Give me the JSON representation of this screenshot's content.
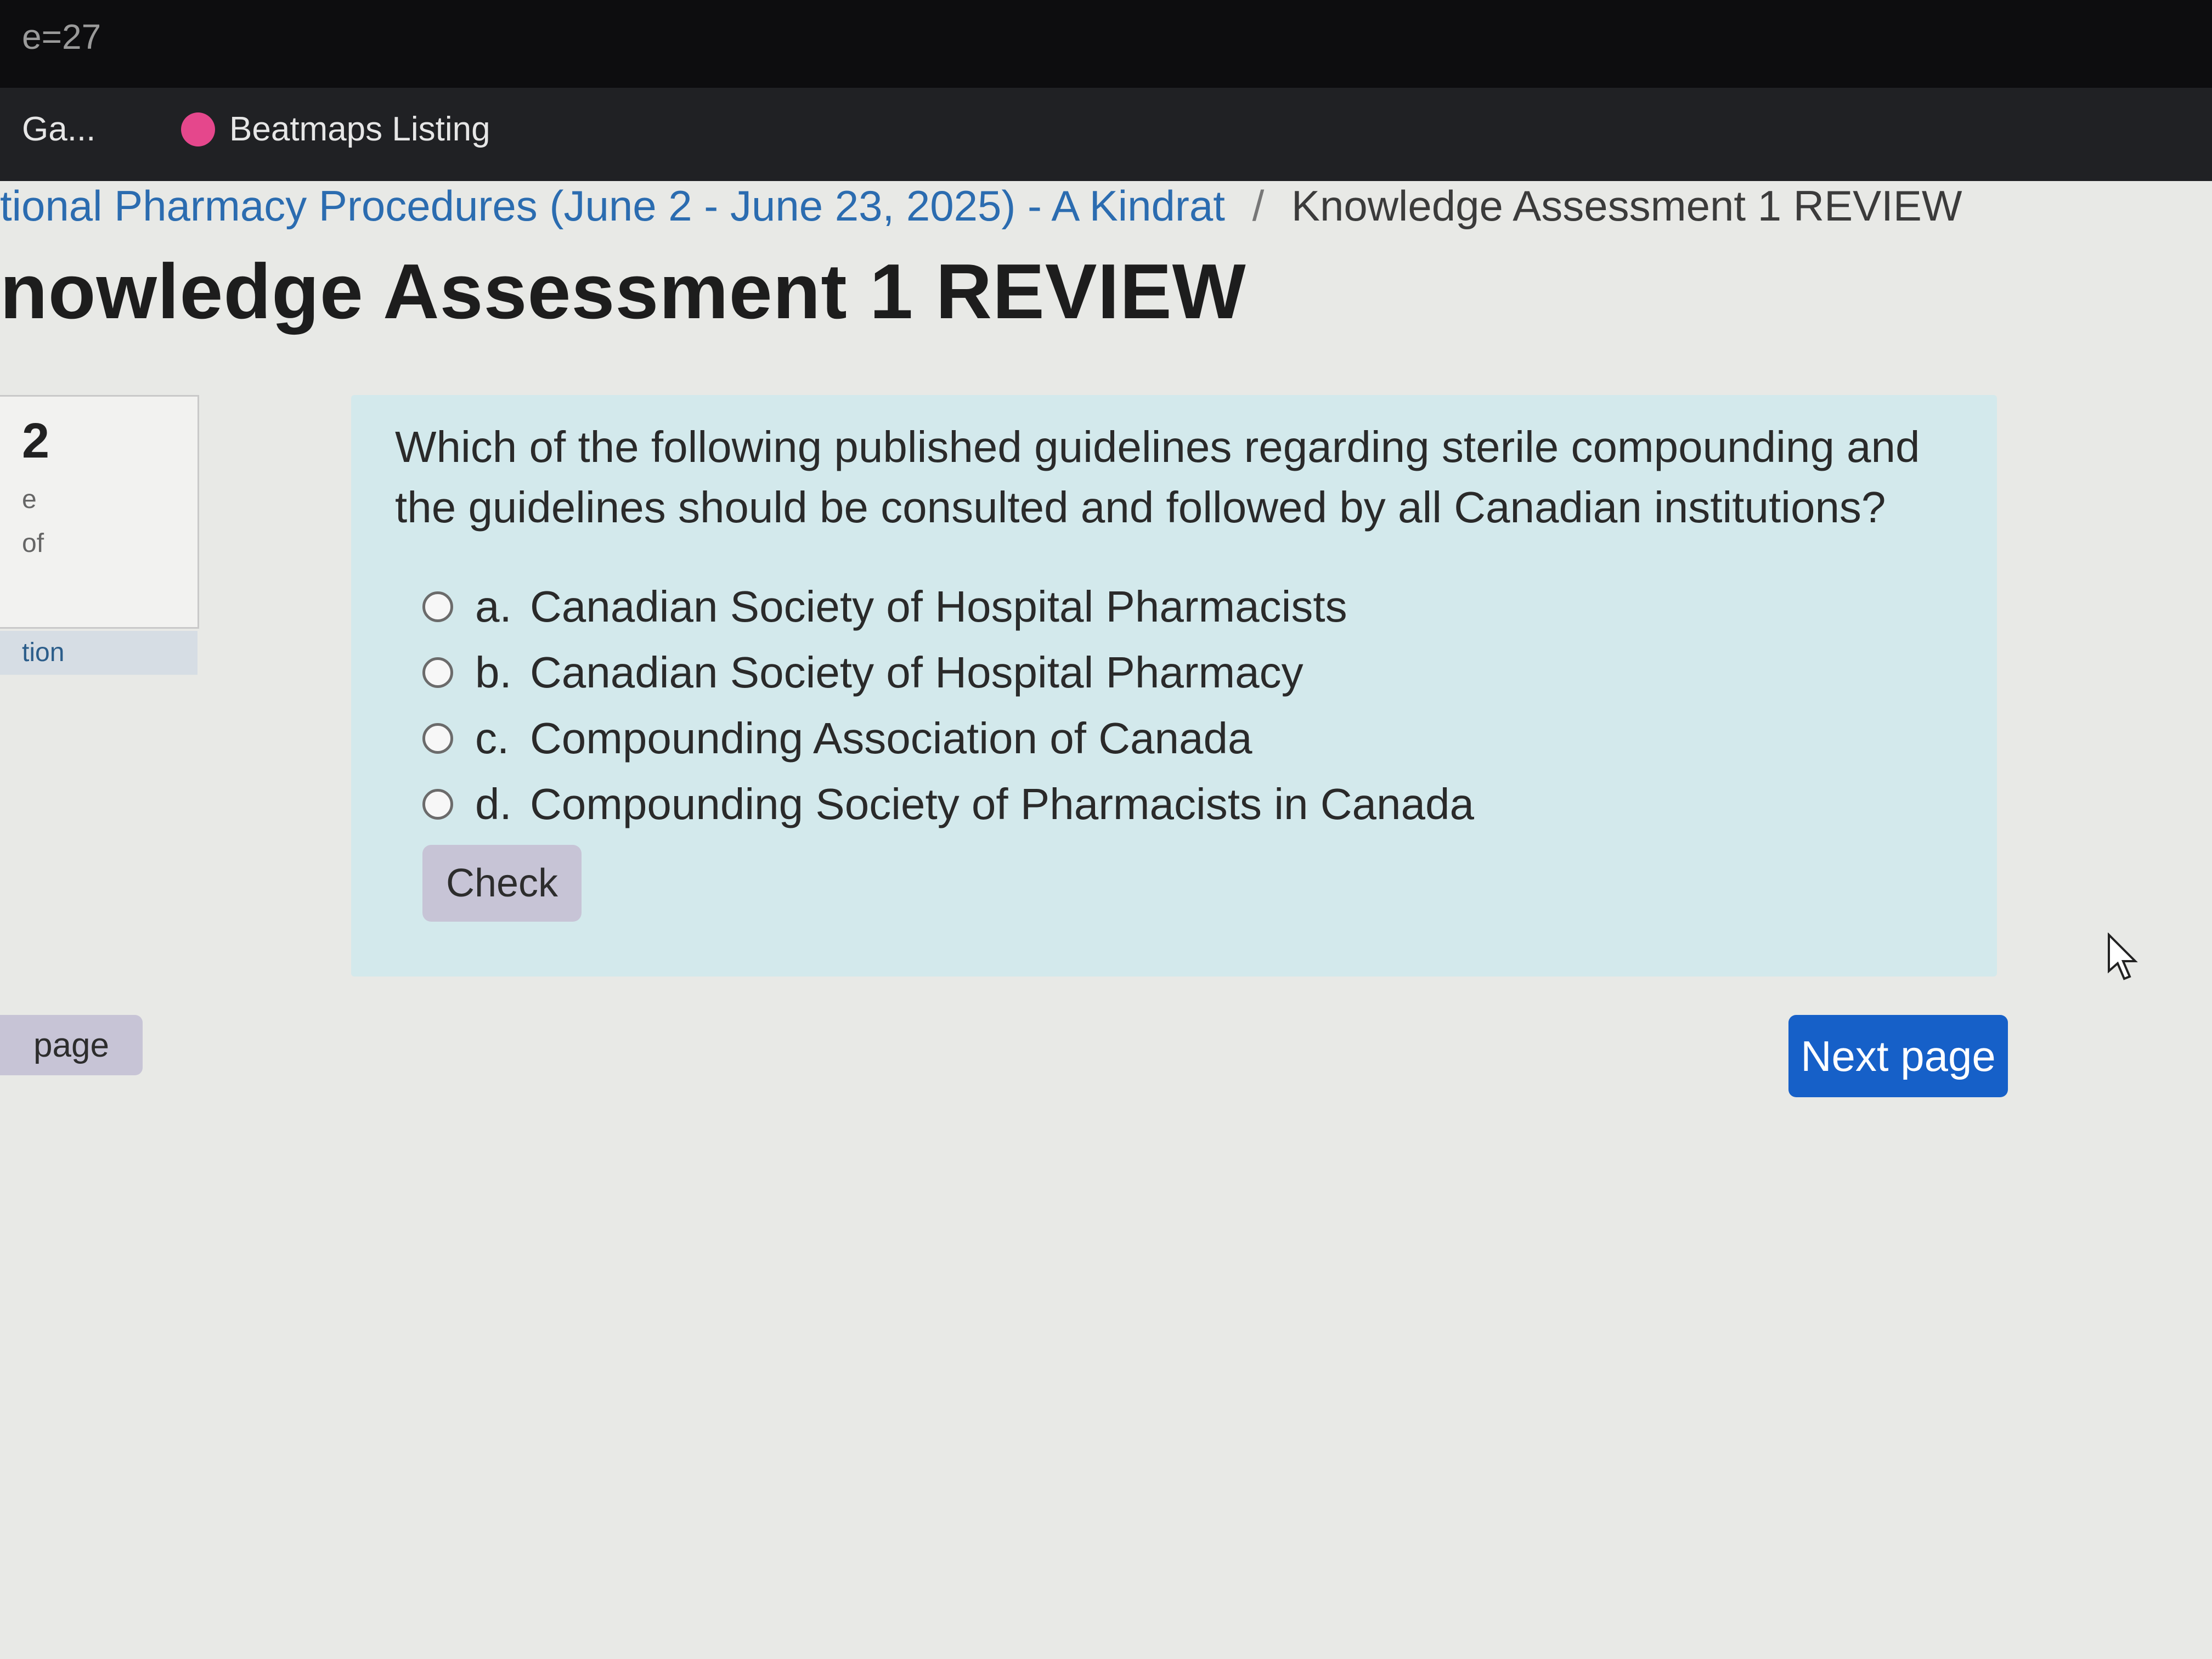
{
  "browser": {
    "address_fragment": "e=27",
    "bookmarks": [
      {
        "label": "Ga..."
      },
      {
        "label": "Beatmaps Listing"
      }
    ]
  },
  "breadcrumb": {
    "course": "tional Pharmacy Procedures (June 2 - June 23, 2025) - A Kindrat",
    "separator": "/",
    "current": "Knowledge Assessment 1 REVIEW"
  },
  "page_title": "nowledge Assessment 1 REVIEW",
  "side_panel": {
    "question_number": "2",
    "meta_line1": "e",
    "meta_line2": "of",
    "nav_label": "tion"
  },
  "question": {
    "text": "Which of the following published guidelines regarding sterile compounding and the guidelines should be consulted and followed by all Canadian institutions?",
    "options": [
      {
        "letter": "a.",
        "label": "Canadian Society of Hospital Pharmacists"
      },
      {
        "letter": "b.",
        "label": "Canadian Society of Hospital Pharmacy"
      },
      {
        "letter": "c.",
        "label": "Compounding Association of Canada"
      },
      {
        "letter": "d.",
        "label": "Compounding Society of Pharmacists in Canada"
      }
    ],
    "check_label": "Check"
  },
  "navigation": {
    "prev_label": "page",
    "next_label": "Next page"
  },
  "colors": {
    "accent": "#1660c8",
    "question_bg": "#d3e9ec",
    "check_bg": "#c7c4d6"
  }
}
